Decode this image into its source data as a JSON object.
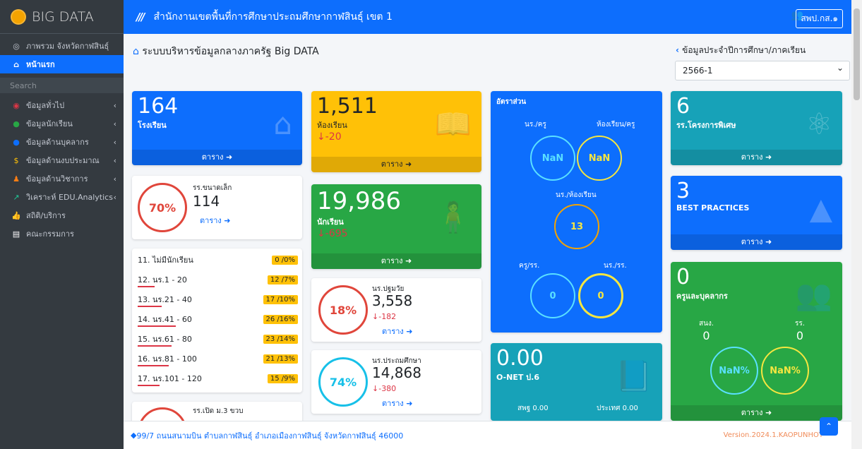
{
  "topbar": {
    "brand": "BIG DATA",
    "office": "สำนักงานเขตพื้นที่การศึกษาประถมศึกษากาฬสินธุ์ เขต 1",
    "user": "สพป.กส.๑"
  },
  "sidebar": {
    "items": [
      {
        "label": "ภาพรวม จังหวัดกาฬสินธุ์",
        "icon": "globe-icon"
      },
      {
        "label": "หน้าแรก",
        "icon": "home-icon",
        "active": true
      },
      {
        "label": "ข้อมูลทั่วไป",
        "icon": "info-icon"
      },
      {
        "label": "ข้อมูลนักเรียน",
        "icon": "student-icon"
      },
      {
        "label": "ข้อมูลด้านบุคลากร",
        "icon": "user-icon"
      },
      {
        "label": "ข้อมูลด้านงบประมาณ",
        "icon": "money-icon"
      },
      {
        "label": "ข้อมูลด้านวิชาการ",
        "icon": "academic-icon"
      },
      {
        "label": "วิเคราะห์ EDU.Analytics",
        "icon": "chart-icon"
      },
      {
        "label": "สถิติ/บริการ",
        "icon": "thumb-icon"
      },
      {
        "label": "คณะกรรมการ",
        "icon": "card-icon"
      }
    ],
    "search": "Search"
  },
  "main": {
    "title": "ระบบบริหารข้อมูลกลางภาครัฐ Big DATA",
    "year_label": "ข้อมูลประจำปีการศึกษา/ภาคเรียน",
    "year": "2566-1"
  },
  "cards": {
    "schools": {
      "num": "164",
      "label": "โรงเรียน",
      "footer": "ตาราง"
    },
    "rooms": {
      "num": "1,511",
      "label": "ห้องเรียน",
      "delta": "-20",
      "footer": "ตาราง"
    },
    "students": {
      "num": "19,986",
      "label": "นักเรียน",
      "delta": "-695",
      "footer": "ตาราง"
    },
    "special": {
      "num": "6",
      "label": "รร.โครงการพิเศษ",
      "footer": "ตาราง"
    },
    "best": {
      "num": "3",
      "label": "BEST PRACTICES",
      "footer": "ตาราง"
    },
    "staff": {
      "num": "0",
      "label": "ครูและบุคลากร",
      "a_lbl": "สนง.",
      "a_val": "0",
      "b_lbl": "รร.",
      "b_val": "0",
      "c1": "NaN%",
      "c2": "NaN%",
      "footer": "ตาราง"
    },
    "onet": {
      "num": "0.00",
      "label": "O-NET ป.6",
      "a": "สพฐ 0.00",
      "b": "ประเทศ 0.00"
    }
  },
  "ratio": {
    "title": "อัตราส่วน",
    "r1": "นร./ครู",
    "r2": "ห้องเรียน/ครู",
    "v1": "NaN",
    "v2": "NaN",
    "r3": "นร./ห้องเรียน",
    "v3": "13",
    "r4": "ครู/รร.",
    "r5": "นร./รร.",
    "v4": "0",
    "v5": "0"
  },
  "small": {
    "pct": "70%",
    "label": "รร.ขนาดเล็ก",
    "num": "114",
    "footer": "ตาราง"
  },
  "sizes": [
    {
      "label": "11. ไม่มีนักเรียน",
      "badge": "0 /0%",
      "fill": 0
    },
    {
      "label": "12. นร.1 - 20",
      "badge": "12 /7%",
      "fill": 7
    },
    {
      "label": "13. นร.21 - 40",
      "badge": "17 /10%",
      "fill": 10
    },
    {
      "label": "14. นร.41 - 60",
      "badge": "26 /16%",
      "fill": 16
    },
    {
      "label": "15. นร.61 - 80",
      "badge": "23 /14%",
      "fill": 14
    },
    {
      "label": "16. นร.81 - 100",
      "badge": "21 /13%",
      "fill": 13
    },
    {
      "label": "17. นร.101 - 120",
      "badge": "15 /9%",
      "fill": 9
    }
  ],
  "pre": {
    "pct": "18%",
    "label": "นร.ปฐมวัย",
    "num": "3,558",
    "delta": "-182",
    "footer": "ตาราง"
  },
  "prim": {
    "pct": "74%",
    "label": "นร.ประถมศึกษา",
    "num": "14,868",
    "delta": "-380",
    "footer": "ตาราง"
  },
  "m3": {
    "label": "รร.เปิด ม.3 ขวบ"
  },
  "footer": {
    "address": "99/7 ถนนสนามบิน ตำบลกาฬสินธุ์ อำเภอเมืองกาฬสินธุ์ จังหวัดกาฬสินธุ์ 46000",
    "version": "Version.2024.1.KAOPUNHOT"
  },
  "colors": {
    "blue": "#0d6efd",
    "yellow": "#ffc107",
    "green": "#28a745",
    "teal": "#17a2b8"
  }
}
